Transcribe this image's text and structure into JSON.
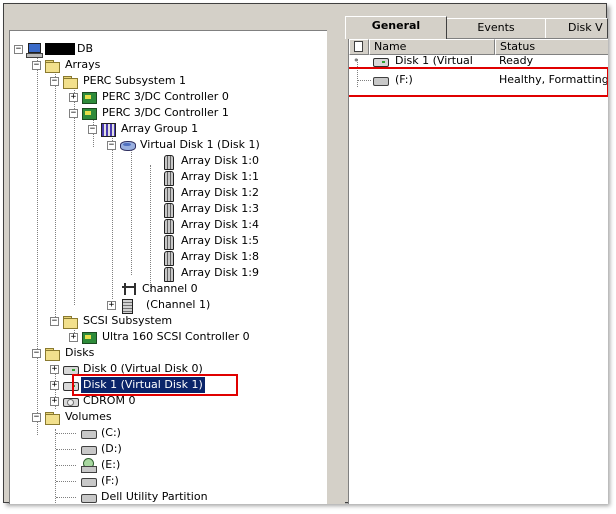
{
  "tree": {
    "root": "DB",
    "arrays": "Arrays",
    "perc_subsystem": "PERC Subsystem 1",
    "controller0": "PERC 3/DC Controller 0",
    "controller1": "PERC 3/DC Controller 1",
    "array_group": "Array Group 1",
    "virtual_disk": "Virtual Disk 1  (Disk 1)",
    "array_disks": [
      "Array Disk 1:0",
      "Array Disk 1:1",
      "Array Disk 1:2",
      "Array Disk 1:3",
      "Array Disk 1:4",
      "Array Disk 1:5",
      "Array Disk 1:8",
      "Array Disk 1:9"
    ],
    "channel0": "Channel 0",
    "channel1": "(Channel 1)",
    "scsi_subsystem": "SCSI Subsystem",
    "ultra_controller": "Ultra 160 SCSI Controller 0",
    "disks": "Disks",
    "disk0": "Disk 0  (Virtual Disk 0)",
    "disk1": "Disk 1  (Virtual Disk 1)",
    "cdrom": "CDROM 0",
    "volumes": "Volumes",
    "vol_items": [
      "(C:)",
      "(D:)",
      "(E:)",
      "(F:)",
      "Dell Utility Partition"
    ]
  },
  "tabs": [
    "General",
    "Events",
    "Disk V"
  ],
  "list": {
    "columns": [
      "Name",
      "Status"
    ],
    "rows": [
      {
        "name": "Disk 1  (Virtual",
        "status": "Ready"
      },
      {
        "name": "(F:)",
        "status": "Healthy, Formatting"
      }
    ]
  },
  "colors": {
    "selection": "#0a246a",
    "highlight_box": "#e00000"
  }
}
